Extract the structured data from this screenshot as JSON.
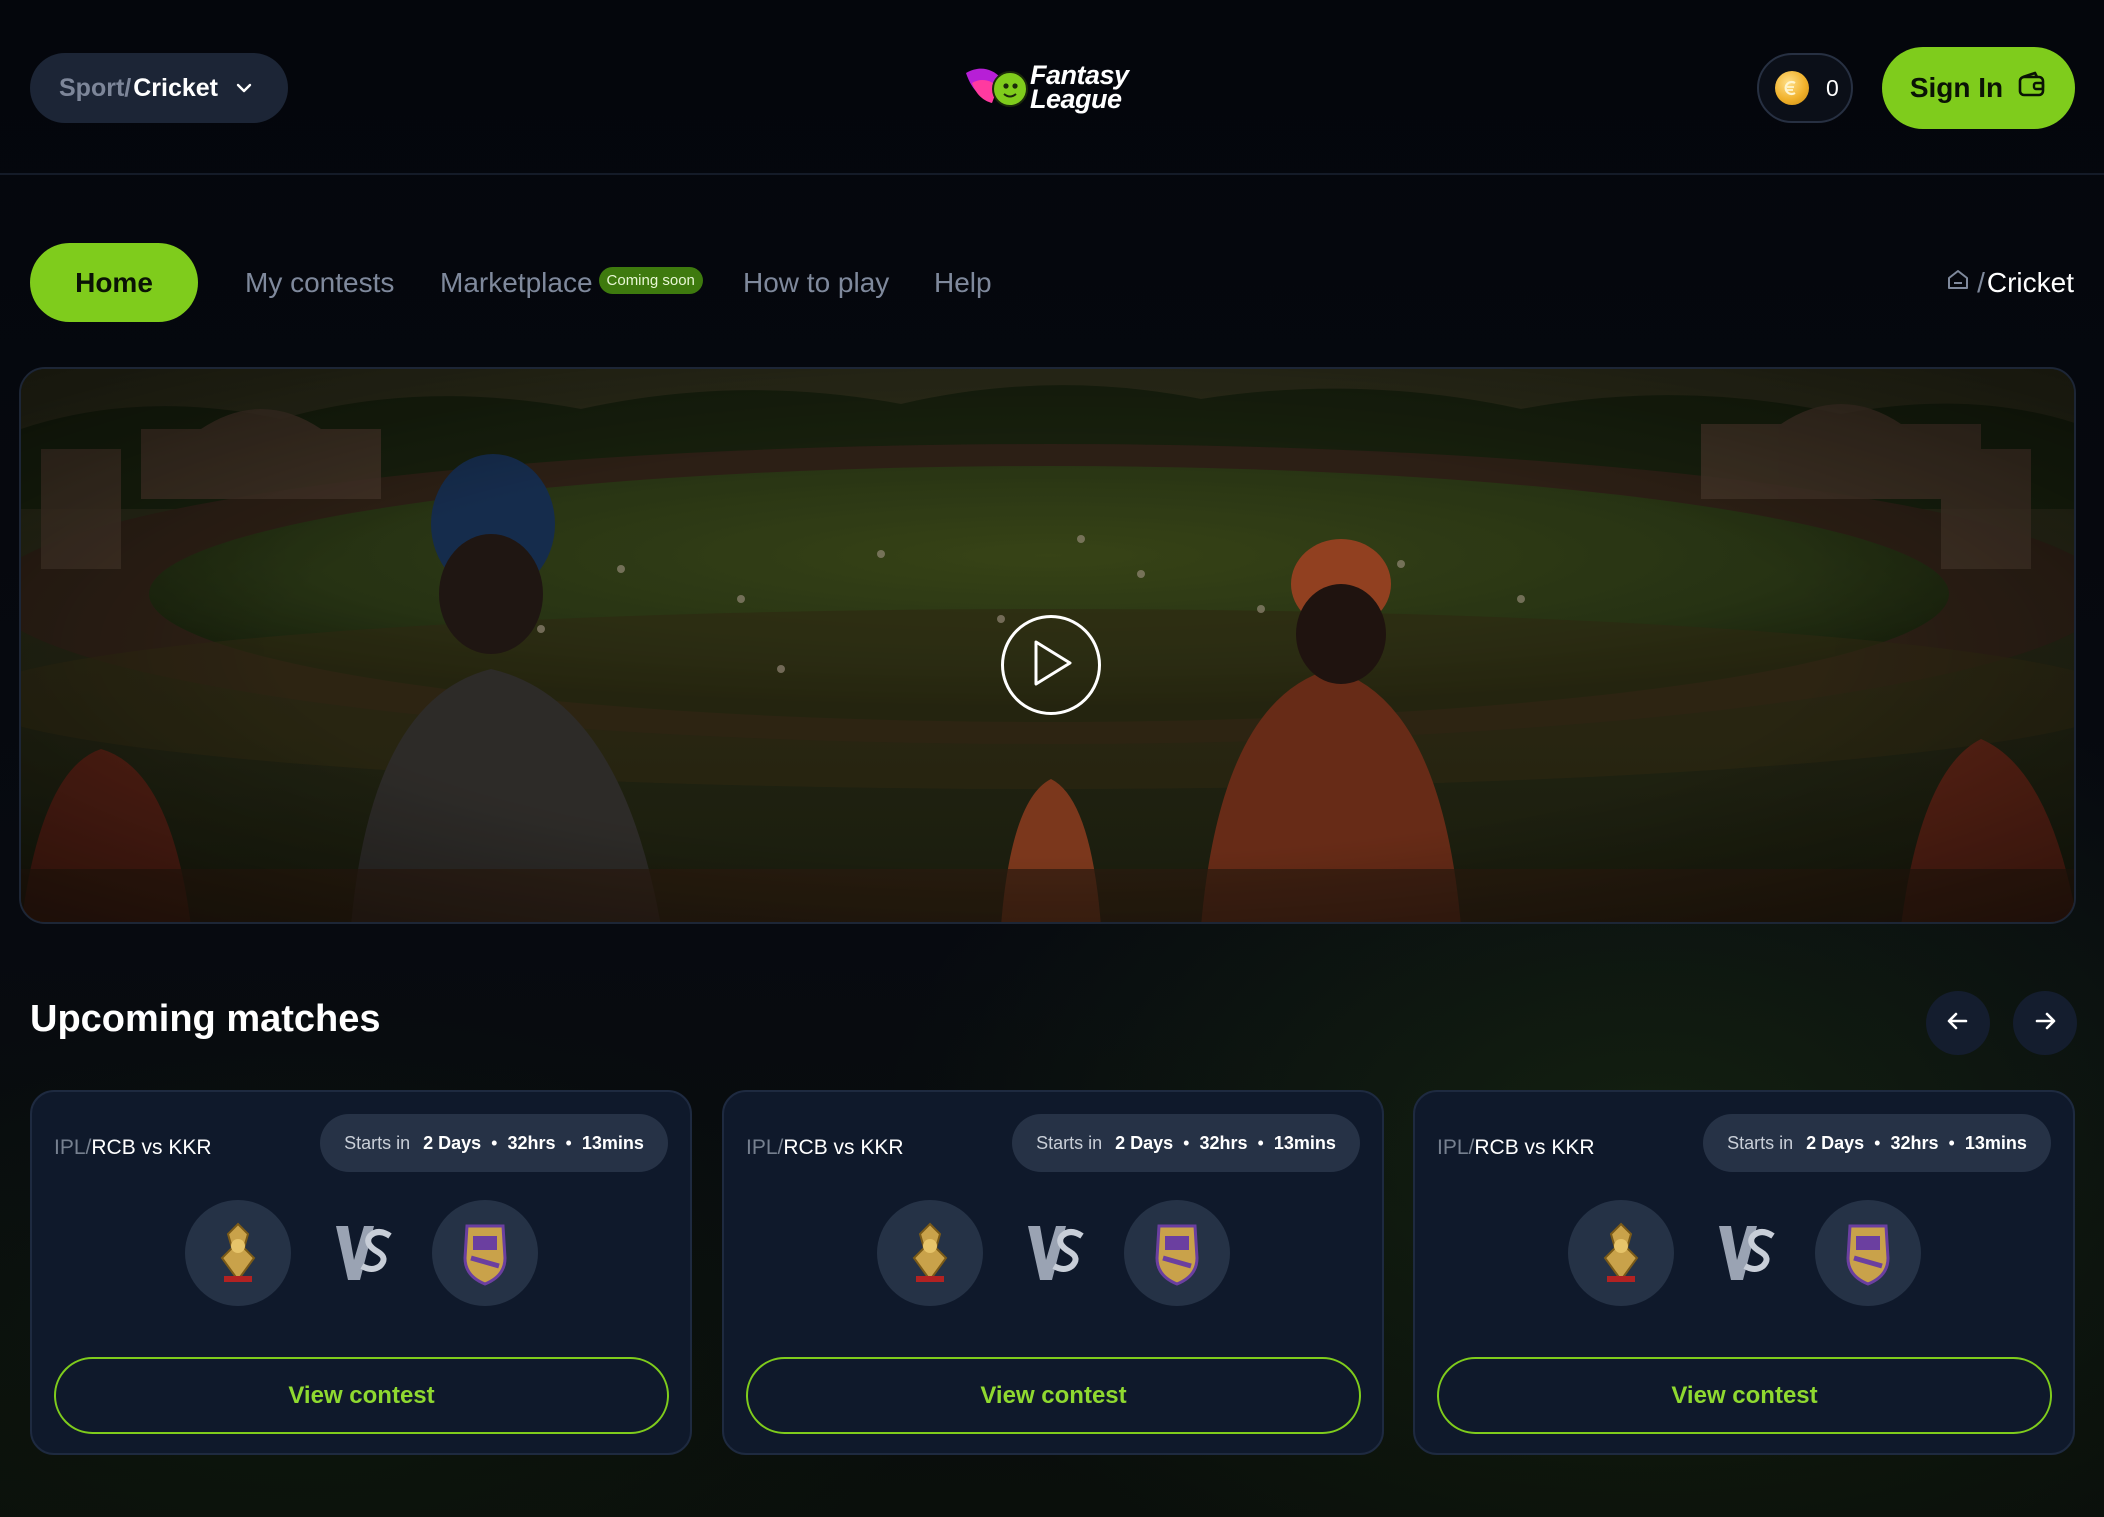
{
  "header": {
    "sport_prefix": "Sport/",
    "sport_value": "Cricket",
    "logo_line1": "Fantasy",
    "logo_line2": "League",
    "coin_count": "0",
    "signin_label": "Sign In"
  },
  "nav": {
    "home": "Home",
    "my_contests": "My contests",
    "marketplace": "Marketplace",
    "marketplace_badge": "Coming soon",
    "how_to_play": "How to play",
    "help": "Help",
    "breadcrumb_sep": "/",
    "breadcrumb_current": "Cricket"
  },
  "hero": {
    "icon": "play-icon"
  },
  "upcoming": {
    "title": "Upcoming matches",
    "cards": [
      {
        "league": "IPL/",
        "match": "RCB vs KKR",
        "starts_label": "Starts in",
        "days": "2 Days",
        "hrs": "32hrs",
        "mins": "13mins",
        "home": "RCB",
        "away": "KKR",
        "cta": "View contest"
      },
      {
        "league": "IPL/",
        "match": "RCB vs KKR",
        "starts_label": "Starts in",
        "days": "2 Days",
        "hrs": "32hrs",
        "mins": "13mins",
        "home": "RCB",
        "away": "KKR",
        "cta": "View contest"
      },
      {
        "league": "IPL/",
        "match": "RCB vs KKR",
        "starts_label": "Starts in",
        "days": "2 Days",
        "hrs": "32hrs",
        "mins": "13mins",
        "home": "RCB",
        "away": "KKR",
        "cta": "View contest"
      }
    ]
  },
  "theme": {
    "accent": "#7fcc1c",
    "background": "#05070c",
    "card": "#0f192b"
  }
}
